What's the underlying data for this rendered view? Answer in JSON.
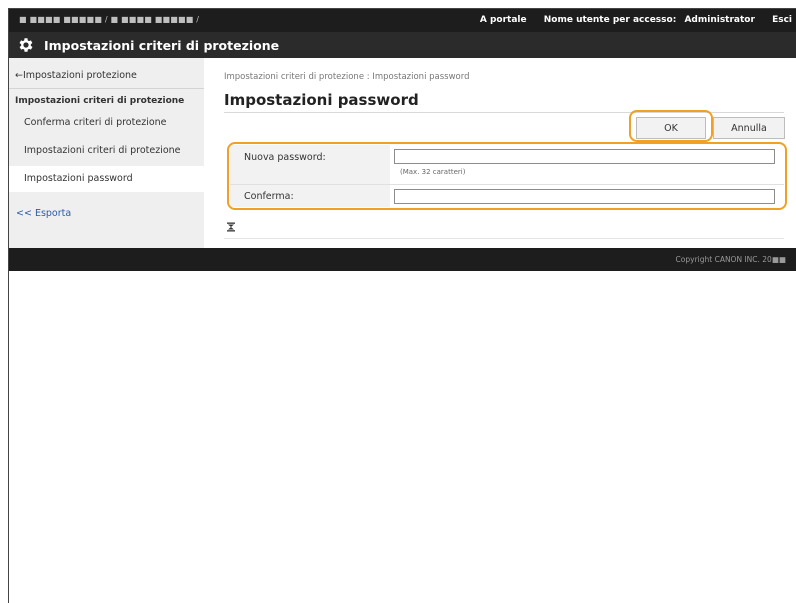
{
  "topbar": {
    "host": "■ ■■■■ ■■■■■ / ■ ■■■■ ■■■■■ /",
    "portal_link": "A portale",
    "login_user_label": "Nome utente per accesso:",
    "login_user_value": "Administrator",
    "logout_link": "Esci"
  },
  "titlebar": {
    "icon": "gear-icon",
    "title": "Impostazioni criteri di protezione"
  },
  "sidebar": {
    "back_link": "←Impostazioni protezione",
    "group_title": "Impostazioni criteri di protezione",
    "items": [
      {
        "label": "Conferma criteri di protezione"
      },
      {
        "label": "Impostazioni criteri di protezione"
      },
      {
        "label": "Impostazioni password",
        "active": true
      }
    ],
    "export_link": "<< Esporta"
  },
  "main": {
    "breadcrumb": "Impostazioni criteri di protezione : Impostazioni password",
    "page_title": "Impostazioni password",
    "ok_button": "OK",
    "cancel_button": "Annulla",
    "form": {
      "new_password_label": "Nuova password:",
      "new_password_value": "",
      "new_password_hint": "(Max. 32 caratteri)",
      "confirm_label": "Conferma:",
      "confirm_value": ""
    },
    "collapse_icon": "collapse-icon"
  },
  "footer": {
    "copyright": "Copyright CANON INC. 20■■"
  },
  "colors": {
    "highlight": "#f0a023",
    "header_bg": "#1d1d1d",
    "title_bg": "#2b2b2b",
    "sidebar_bg": "#efefef",
    "link": "#2a5caa"
  }
}
